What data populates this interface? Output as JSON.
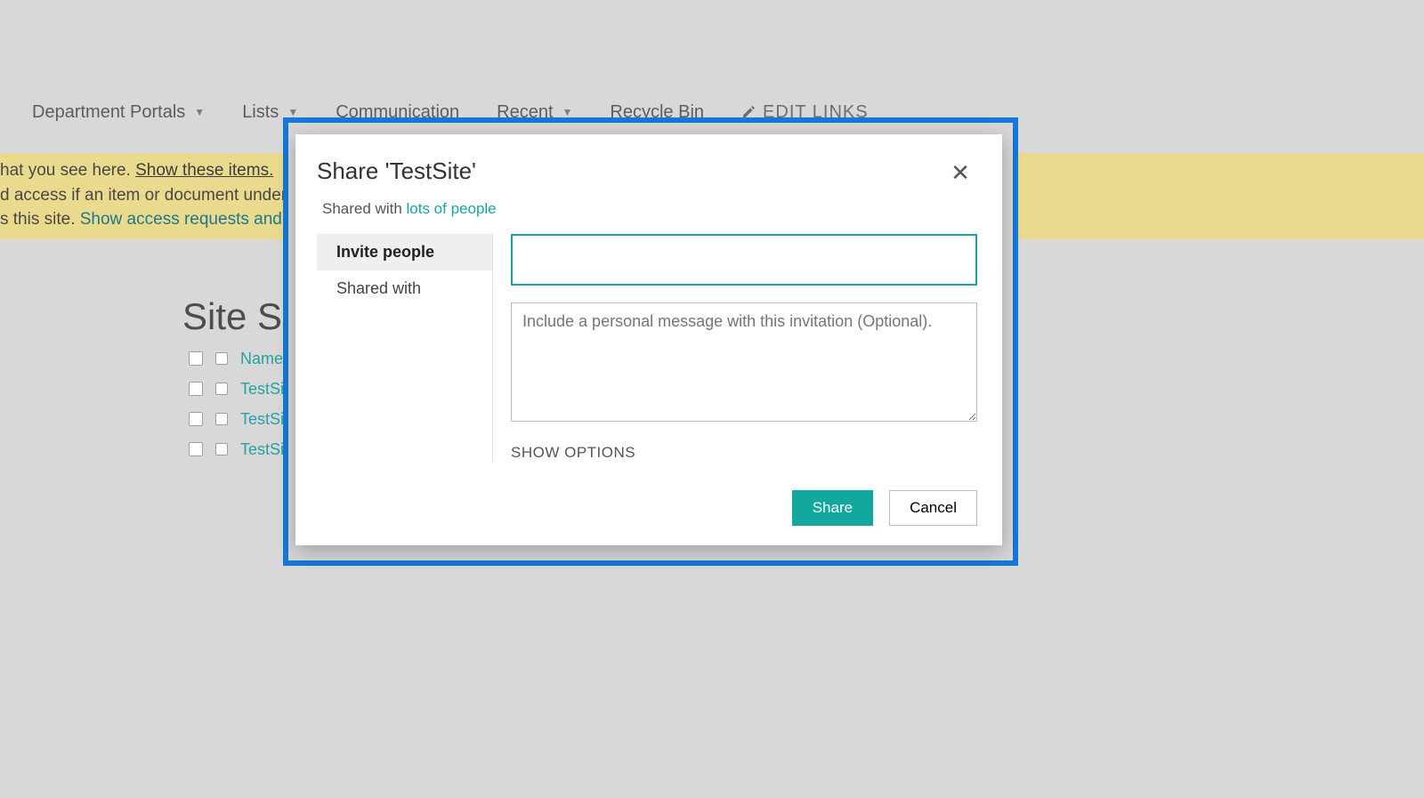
{
  "topnav": {
    "items": [
      {
        "label": "Department Portals",
        "hasCaret": true
      },
      {
        "label": "Lists",
        "hasCaret": true
      },
      {
        "label": "Communication",
        "hasCaret": false
      },
      {
        "label": "Recent",
        "hasCaret": true
      },
      {
        "label": "Recycle Bin",
        "hasCaret": false
      }
    ],
    "editLinks": "EDIT LINKS"
  },
  "notice": {
    "line1_prefix": "hat you see here.  ",
    "line1_link": "Show these items.",
    "line2": "d access if an item or document under the site",
    "line3_prefix": "s this site. ",
    "line3_link": "Show access requests and invitation"
  },
  "page": {
    "heading": "Site Sett",
    "nameHeader": "Name",
    "rows": [
      "TestSi",
      "TestSi",
      "TestSi"
    ]
  },
  "modal": {
    "title": "Share 'TestSite'",
    "sharedWithPrefix": "Shared with ",
    "sharedWithLink": "lots of people",
    "tabs": {
      "invite": "Invite people",
      "shared": "Shared with"
    },
    "peoplePlaceholder": "",
    "messagePlaceholder": "Include a personal message with this invitation (Optional).",
    "showOptions": "SHOW OPTIONS",
    "shareBtn": "Share",
    "cancelBtn": "Cancel"
  }
}
